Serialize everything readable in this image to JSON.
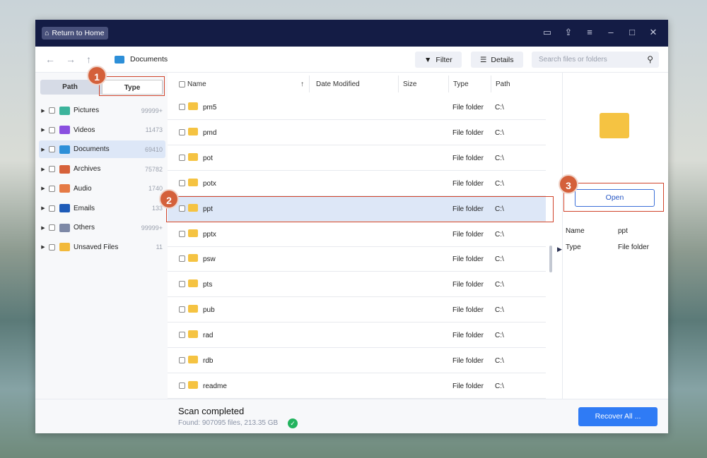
{
  "title_bar": {
    "home_label": "Return to Home",
    "controls": [
      "feedback-icon",
      "upload-icon",
      "menu-icon",
      "minimize-icon",
      "maximize-icon",
      "close-icon"
    ]
  },
  "toolbar": {
    "breadcrumb": "Documents",
    "filter_label": "Filter",
    "details_label": "Details",
    "search_placeholder": "Search files or folders"
  },
  "sidebar": {
    "tabs": [
      "Path",
      "Type"
    ],
    "active_tab": "Type",
    "items": [
      {
        "label": "Pictures",
        "count": "99999+",
        "color": "#3bb39b"
      },
      {
        "label": "Videos",
        "count": "11473",
        "color": "#8a4fe0"
      },
      {
        "label": "Documents",
        "count": "69410",
        "color": "#2d8fd8"
      },
      {
        "label": "Archives",
        "count": "75782",
        "color": "#d6613a"
      },
      {
        "label": "Audio",
        "count": "1740",
        "color": "#e57a45"
      },
      {
        "label": "Emails",
        "count": "133",
        "color": "#1e5bb8"
      },
      {
        "label": "Others",
        "count": "99999+",
        "color": "#7d88a6"
      },
      {
        "label": "Unsaved Files",
        "count": "11",
        "color": "#f2b93b"
      }
    ]
  },
  "columns": [
    "Name",
    "Date Modified",
    "Size",
    "Type",
    "Path"
  ],
  "rows": [
    {
      "name": "pm5",
      "type": "File folder",
      "path": "C:\\"
    },
    {
      "name": "pmd",
      "type": "File folder",
      "path": "C:\\"
    },
    {
      "name": "pot",
      "type": "File folder",
      "path": "C:\\"
    },
    {
      "name": "potx",
      "type": "File folder",
      "path": "C:\\"
    },
    {
      "name": "ppt",
      "type": "File folder",
      "path": "C:\\"
    },
    {
      "name": "pptx",
      "type": "File folder",
      "path": "C:\\"
    },
    {
      "name": "psw",
      "type": "File folder",
      "path": "C:\\"
    },
    {
      "name": "pts",
      "type": "File folder",
      "path": "C:\\"
    },
    {
      "name": "pub",
      "type": "File folder",
      "path": "C:\\"
    },
    {
      "name": "rad",
      "type": "File folder",
      "path": "C:\\"
    },
    {
      "name": "rdb",
      "type": "File folder",
      "path": "C:\\"
    },
    {
      "name": "readme",
      "type": "File folder",
      "path": "C:\\"
    }
  ],
  "selected_row": 4,
  "preview": {
    "open_label": "Open",
    "name_label": "Name",
    "name_value": "ppt",
    "type_label": "Type",
    "type_value": "File folder"
  },
  "footer": {
    "status": "Scan completed",
    "found": "Found: 907095 files, 213.35 GB",
    "recover_label": "Recover All ..."
  },
  "annotations": [
    "1",
    "2",
    "3"
  ]
}
